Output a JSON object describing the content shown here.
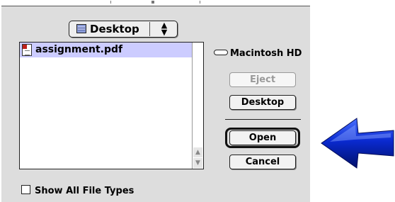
{
  "location_popup": {
    "label": "Desktop",
    "icon": "desktop-folder-icon",
    "arrows_glyph": "▲▼"
  },
  "file_list": {
    "items": [
      {
        "name": "assignment.pdf",
        "icon": "pdf-document-icon",
        "selected": true
      }
    ]
  },
  "volume": {
    "name": "Macintosh HD",
    "icon": "hard-disk-icon"
  },
  "buttons": {
    "eject": "Eject",
    "desktop": "Desktop",
    "open": "Open",
    "cancel": "Cancel"
  },
  "checkbox": {
    "label": "Show All File Types",
    "checked": false
  },
  "colors": {
    "selection": "#ccccff",
    "dialog_bg": "#dddddd",
    "arrow_blue": "#1030c8"
  },
  "annotation": {
    "icon": "left-arrow-pointer-icon"
  }
}
